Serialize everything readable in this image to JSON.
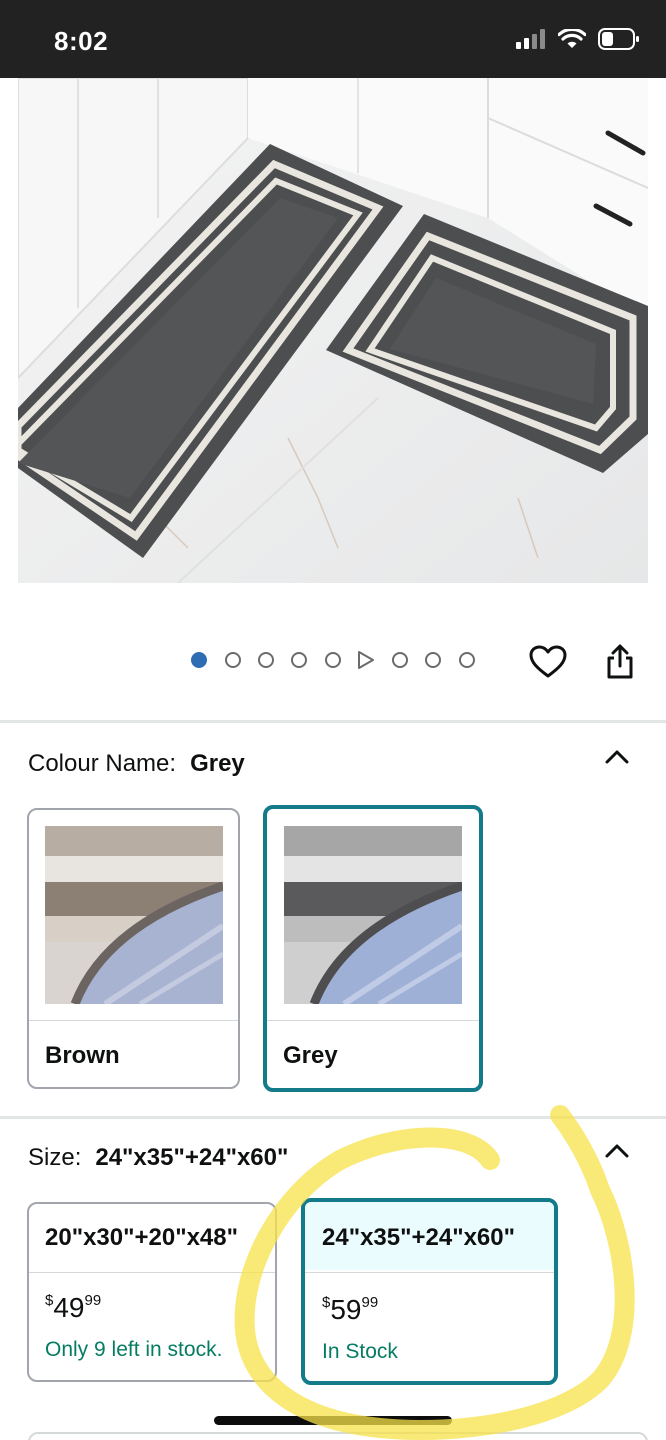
{
  "status_bar": {
    "time": "8:02"
  },
  "product": {
    "image_icon": "product-photo-kitchen-rugs",
    "carousel": {
      "total_dots": 9,
      "active_index": 0,
      "video_index": 5
    }
  },
  "colour": {
    "label": "Colour Name:",
    "selected": "Grey",
    "options": [
      {
        "name": "Brown"
      },
      {
        "name": "Grey"
      }
    ]
  },
  "size": {
    "label": "Size:",
    "selected": "24\"x35\"+24\"x60\"",
    "options": [
      {
        "title": "20\"x30\"+20\"x48\"",
        "price_symbol": "$",
        "price_whole": "49",
        "price_cents": "99",
        "stock": "Only 9 left in stock."
      },
      {
        "title": "24\"x35\"+24\"x60\"",
        "price_symbol": "$",
        "price_whole": "59",
        "price_cents": "99",
        "stock": "In Stock"
      }
    ]
  },
  "colors": {
    "accent": "#137a8a",
    "stock_green": "#067d62",
    "active_dot": "#2e6db4",
    "highlight": "#f7e24a"
  }
}
